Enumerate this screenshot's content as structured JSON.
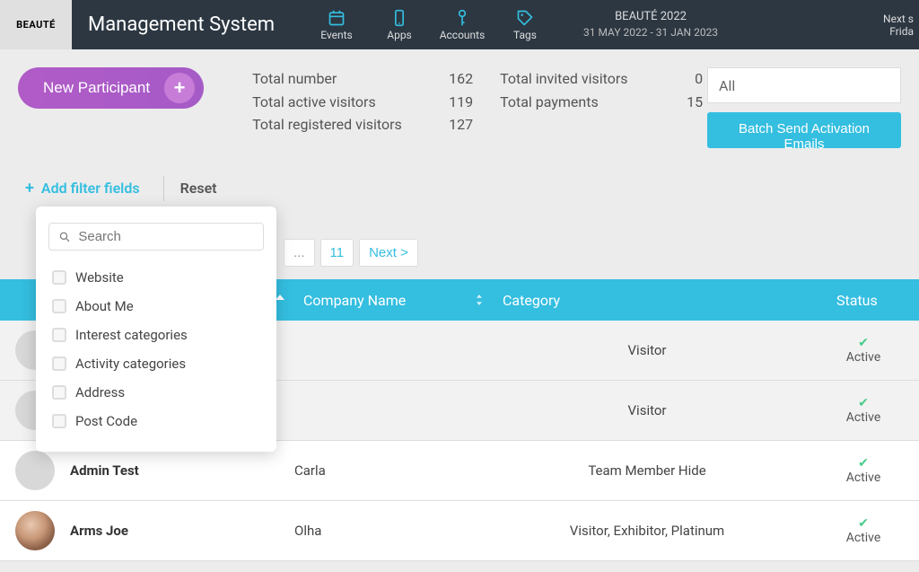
{
  "header": {
    "logo_text": "BEAUTÉ",
    "app_title": "Management System",
    "nav": {
      "events": "Events",
      "apps": "Apps",
      "accounts": "Accounts",
      "tags": "Tags"
    },
    "event_info": {
      "name": "BEAUTÉ 2022",
      "dates": "31 MAY 2022 - 31 JAN 2023"
    },
    "right_partial": {
      "line1": "Next s",
      "line2": "Frida"
    }
  },
  "toolbar": {
    "new_participant_label": "New Participant"
  },
  "stats": {
    "total_number_label": "Total number",
    "total_number_val": "162",
    "total_active_label": "Total active visitors",
    "total_active_val": "119",
    "total_registered_label": "Total registered visitors",
    "total_registered_val": "127",
    "total_invited_label": "Total invited visitors",
    "total_invited_val": "0",
    "total_payments_label": "Total payments",
    "total_payments_val": "15"
  },
  "right_tools": {
    "select_value": "All",
    "batch_button": "Batch Send Activation Emails"
  },
  "filter_bar": {
    "add_filter_label": "Add filter fields",
    "reset_label": "Reset"
  },
  "filter_panel": {
    "search_placeholder": "Search",
    "options": [
      "Website",
      "About Me",
      "Interest categories",
      "Activity categories",
      "Address",
      "Post Code"
    ]
  },
  "pagination": {
    "ellipsis": "...",
    "page": "11",
    "next": "Next >"
  },
  "table": {
    "columns": {
      "company": "Company Name",
      "category": "Category",
      "status": "Status"
    },
    "rows": [
      {
        "name": "",
        "company": "",
        "category": "Visitor",
        "status": "Active",
        "avatar": "placeholder"
      },
      {
        "name": "",
        "company": "",
        "category": "Visitor",
        "status": "Active",
        "avatar": "placeholder"
      },
      {
        "name": "Admin Test",
        "company": "Carla",
        "category": "Team Member Hide",
        "status": "Active",
        "avatar": "placeholder"
      },
      {
        "name": "Arms Joe",
        "company": "Olha",
        "category": "Visitor, Exhibitor, Platinum",
        "status": "Active",
        "avatar": "photo"
      }
    ]
  }
}
